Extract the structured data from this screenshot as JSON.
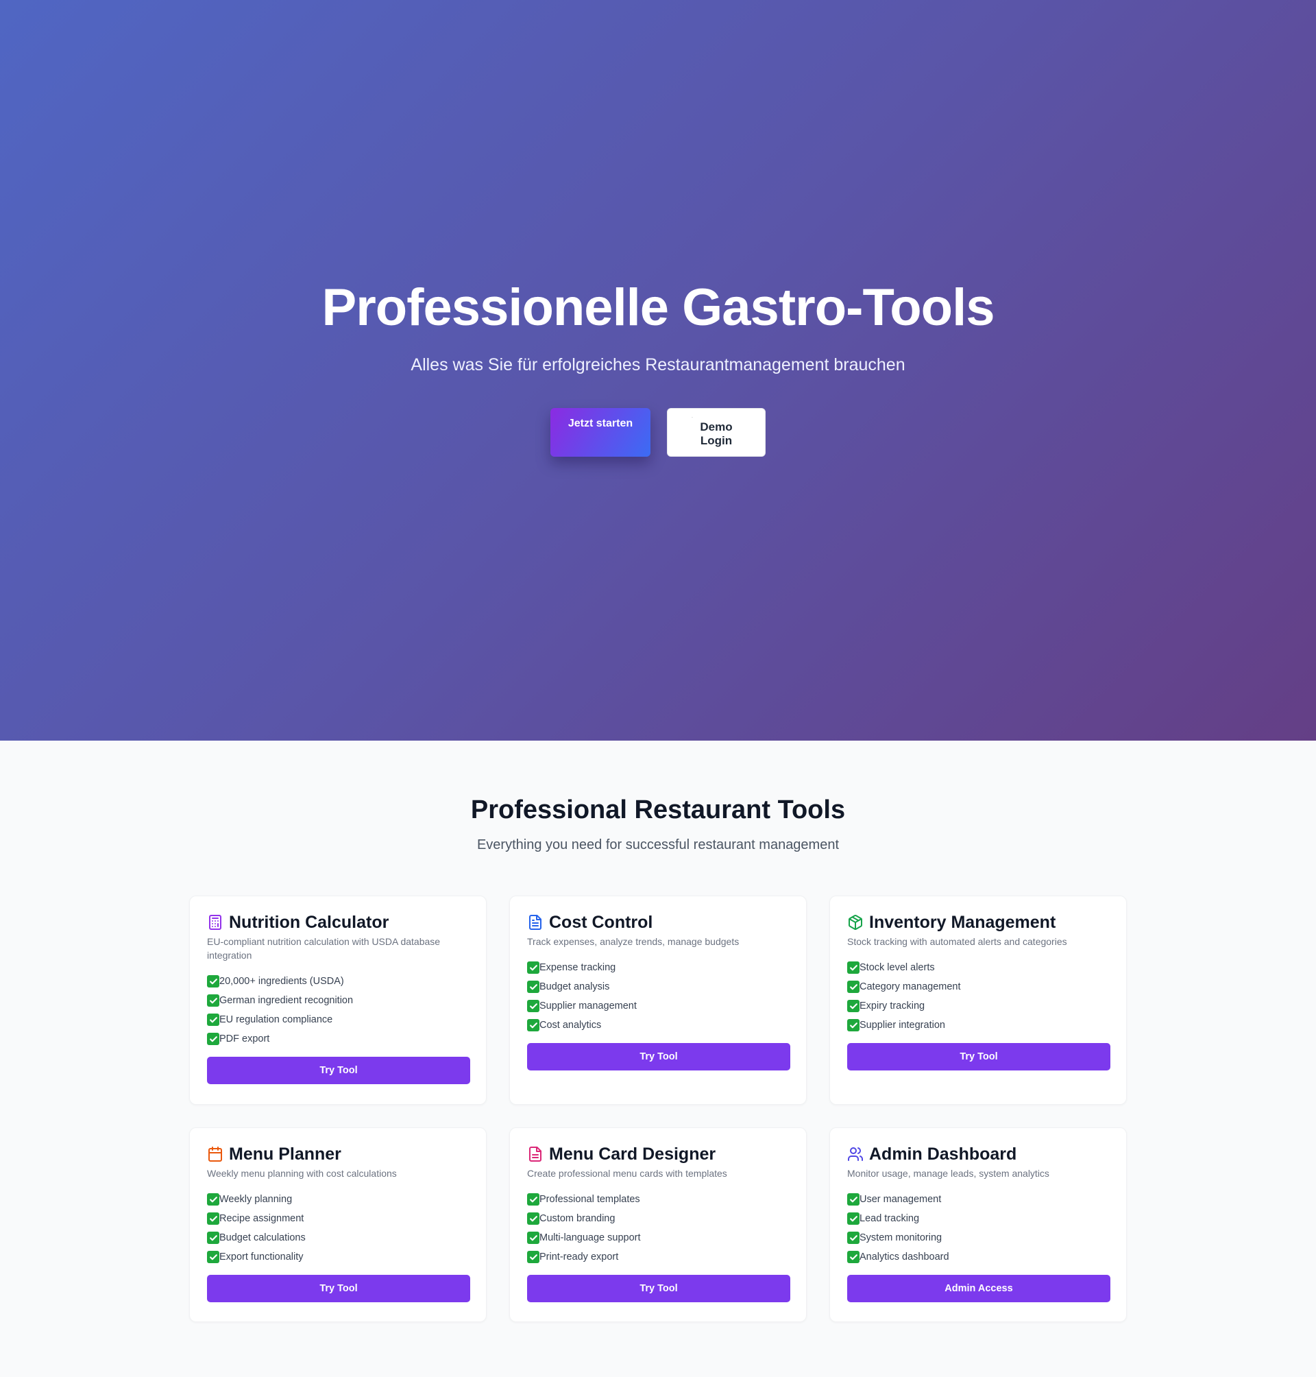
{
  "hero": {
    "title": "Professionelle Gastro-Tools",
    "subtitle": "Alles was Sie für erfolgreiches Restaurantmanagement brauchen",
    "start_label": "Jetzt starten",
    "demo_label": "Demo Login",
    "demo_icon": "chef-hat-icon"
  },
  "tools": {
    "title": "Professional Restaurant Tools",
    "subtitle": "Everything you need for successful restaurant management",
    "cards": [
      {
        "icon": "calculator-icon",
        "icon_color": "#9333ea",
        "title": "Nutrition Calculator",
        "desc": "EU-compliant nutrition calculation with USDA database integration",
        "features": [
          "20,000+ ingredients (USDA)",
          "German ingredient recognition",
          "EU regulation compliance",
          "PDF export"
        ],
        "button": "Try Tool"
      },
      {
        "icon": "document-icon",
        "icon_color": "#2563eb",
        "title": "Cost Control",
        "desc": "Track expenses, analyze trends, manage budgets",
        "features": [
          "Expense tracking",
          "Budget analysis",
          "Supplier management",
          "Cost analytics"
        ],
        "button": "Try Tool"
      },
      {
        "icon": "package-icon",
        "icon_color": "#16a34a",
        "title": "Inventory Management",
        "desc": "Stock tracking with automated alerts and categories",
        "features": [
          "Stock level alerts",
          "Category management",
          "Expiry tracking",
          "Supplier integration"
        ],
        "button": "Try Tool"
      },
      {
        "icon": "calendar-icon",
        "icon_color": "#ea580c",
        "title": "Menu Planner",
        "desc": "Weekly menu planning with cost calculations",
        "features": [
          "Weekly planning",
          "Recipe assignment",
          "Budget calculations",
          "Export functionality"
        ],
        "button": "Try Tool"
      },
      {
        "icon": "file-text-icon",
        "icon_color": "#db2777",
        "title": "Menu Card Designer",
        "desc": "Create professional menu cards with templates",
        "features": [
          "Professional templates",
          "Custom branding",
          "Multi-language support",
          "Print-ready export"
        ],
        "button": "Try Tool"
      },
      {
        "icon": "users-icon",
        "icon_color": "#4f46e5",
        "title": "Admin Dashboard",
        "desc": "Monitor usage, manage leads, system analytics",
        "features": [
          "User management",
          "Lead tracking",
          "System monitoring",
          "Analytics dashboard"
        ],
        "button": "Admin Access"
      }
    ]
  },
  "colors": {
    "accent": "#7c3aed",
    "check": "#1ea83c",
    "hero_gradient_start": "#5066c3",
    "hero_gradient_end": "#643f86"
  }
}
